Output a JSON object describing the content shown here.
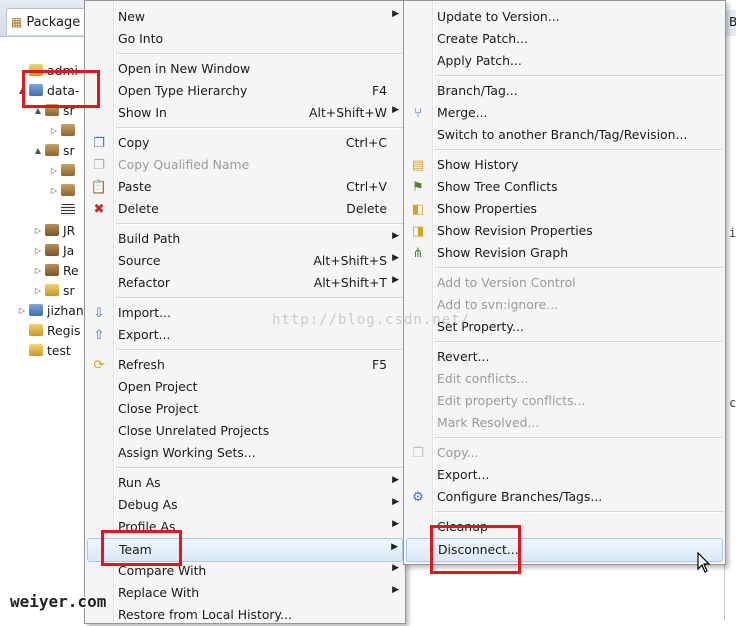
{
  "explorer": {
    "tab_label": "Package",
    "rows": [
      {
        "label": "admi",
        "indent": 0,
        "twisty": "",
        "icon": "folder"
      },
      {
        "label": "data-",
        "indent": 0,
        "twisty": "▲",
        "icon": "proj"
      },
      {
        "label": "sr",
        "indent": 1,
        "twisty": "▲",
        "icon": "pkg"
      },
      {
        "label": "",
        "indent": 2,
        "twisty": "▷",
        "icon": "pkg"
      },
      {
        "label": "sr",
        "indent": 1,
        "twisty": "▲",
        "icon": "pkg"
      },
      {
        "label": "",
        "indent": 2,
        "twisty": "▷",
        "icon": "pkg"
      },
      {
        "label": "",
        "indent": 2,
        "twisty": "▷",
        "icon": "pkg"
      },
      {
        "label": "",
        "indent": 2,
        "twisty": "",
        "icon": "table"
      },
      {
        "label": "JR",
        "indent": 1,
        "twisty": "▷",
        "icon": "lib"
      },
      {
        "label": "Ja",
        "indent": 1,
        "twisty": "▷",
        "icon": "lib"
      },
      {
        "label": "Re",
        "indent": 1,
        "twisty": "▷",
        "icon": "lib"
      },
      {
        "label": "sr",
        "indent": 1,
        "twisty": "▷",
        "icon": "folder"
      },
      {
        "label": "jizhan",
        "indent": 0,
        "twisty": "▷",
        "icon": "proj"
      },
      {
        "label": "Regis",
        "indent": 0,
        "twisty": "",
        "icon": "folder"
      },
      {
        "label": "test",
        "indent": 0,
        "twisty": "",
        "icon": "folder"
      }
    ]
  },
  "editor": {
    "tab_label": "B",
    "chars": [
      "i",
      "c"
    ]
  },
  "context_menu": {
    "items": [
      {
        "type": "item",
        "label": "New",
        "submenu": true
      },
      {
        "type": "item",
        "label": "Go Into"
      },
      {
        "type": "sep"
      },
      {
        "type": "item",
        "label": "Open in New Window"
      },
      {
        "type": "item",
        "label": "Open Type Hierarchy",
        "shortcut": "F4"
      },
      {
        "type": "item",
        "label": "Show In",
        "shortcut": "Alt+Shift+W",
        "submenu": true
      },
      {
        "type": "sep"
      },
      {
        "type": "item",
        "label": "Copy",
        "shortcut": "Ctrl+C",
        "icon": "copy-icon"
      },
      {
        "type": "item",
        "label": "Copy Qualified Name",
        "disabled": true,
        "icon": "copy-qualified-icon"
      },
      {
        "type": "item",
        "label": "Paste",
        "shortcut": "Ctrl+V",
        "icon": "paste-icon"
      },
      {
        "type": "item",
        "label": "Delete",
        "shortcut": "Delete",
        "icon": "delete-icon"
      },
      {
        "type": "sep"
      },
      {
        "type": "item",
        "label": "Build Path",
        "submenu": true
      },
      {
        "type": "item",
        "label": "Source",
        "shortcut": "Alt+Shift+S",
        "submenu": true
      },
      {
        "type": "item",
        "label": "Refactor",
        "shortcut": "Alt+Shift+T",
        "submenu": true
      },
      {
        "type": "sep"
      },
      {
        "type": "item",
        "label": "Import...",
        "icon": "import-icon"
      },
      {
        "type": "item",
        "label": "Export...",
        "icon": "export-icon"
      },
      {
        "type": "sep"
      },
      {
        "type": "item",
        "label": "Refresh",
        "shortcut": "F5",
        "icon": "refresh-icon"
      },
      {
        "type": "item",
        "label": "Open Project"
      },
      {
        "type": "item",
        "label": "Close Project"
      },
      {
        "type": "item",
        "label": "Close Unrelated Projects"
      },
      {
        "type": "item",
        "label": "Assign Working Sets..."
      },
      {
        "type": "sep"
      },
      {
        "type": "item",
        "label": "Run As",
        "submenu": true
      },
      {
        "type": "item",
        "label": "Debug As",
        "submenu": true
      },
      {
        "type": "item",
        "label": "Profile As",
        "submenu": true
      },
      {
        "type": "item",
        "label": "Team",
        "submenu": true,
        "highlighted": true
      },
      {
        "type": "item",
        "label": "Compare With",
        "submenu": true
      },
      {
        "type": "item",
        "label": "Replace With",
        "submenu": true
      },
      {
        "type": "item",
        "label": "Restore from Local History..."
      }
    ]
  },
  "team_menu": {
    "items": [
      {
        "type": "item",
        "label": "Update to Version..."
      },
      {
        "type": "item",
        "label": "Create Patch..."
      },
      {
        "type": "item",
        "label": "Apply Patch..."
      },
      {
        "type": "sep"
      },
      {
        "type": "item",
        "label": "Branch/Tag..."
      },
      {
        "type": "item",
        "label": "Merge...",
        "icon": "merge-icon"
      },
      {
        "type": "item",
        "label": "Switch to another Branch/Tag/Revision..."
      },
      {
        "type": "sep"
      },
      {
        "type": "item",
        "label": "Show History",
        "icon": "history-icon"
      },
      {
        "type": "item",
        "label": "Show Tree Conflicts",
        "icon": "tree-conflicts-icon"
      },
      {
        "type": "item",
        "label": "Show Properties",
        "icon": "properties-icon"
      },
      {
        "type": "item",
        "label": "Show Revision Properties",
        "icon": "revision-properties-icon"
      },
      {
        "type": "item",
        "label": "Show Revision Graph",
        "icon": "revision-graph-icon"
      },
      {
        "type": "sep"
      },
      {
        "type": "item",
        "label": "Add to Version Control",
        "disabled": true
      },
      {
        "type": "item",
        "label": "Add to svn:ignore...",
        "disabled": true
      },
      {
        "type": "item",
        "label": "Set Property..."
      },
      {
        "type": "sep"
      },
      {
        "type": "item",
        "label": "Revert..."
      },
      {
        "type": "item",
        "label": "Edit conflicts...",
        "disabled": true
      },
      {
        "type": "item",
        "label": "Edit property conflicts...",
        "disabled": true
      },
      {
        "type": "item",
        "label": "Mark Resolved...",
        "disabled": true
      },
      {
        "type": "sep"
      },
      {
        "type": "item",
        "label": "Copy...",
        "disabled": true,
        "icon": "copy-disabled-icon"
      },
      {
        "type": "item",
        "label": "Export..."
      },
      {
        "type": "item",
        "label": "Configure Branches/Tags...",
        "icon": "configure-icon"
      },
      {
        "type": "sep"
      },
      {
        "type": "item",
        "label": "Cleanup"
      },
      {
        "type": "item",
        "label": "Disconnect...",
        "highlighted": true
      }
    ]
  },
  "watermarks": {
    "blog": "http://blog.csdn.net/",
    "site": "weiyer.com"
  },
  "colors": {
    "annotation_red": "#e8141b",
    "highlight": "#dbe8f8"
  }
}
